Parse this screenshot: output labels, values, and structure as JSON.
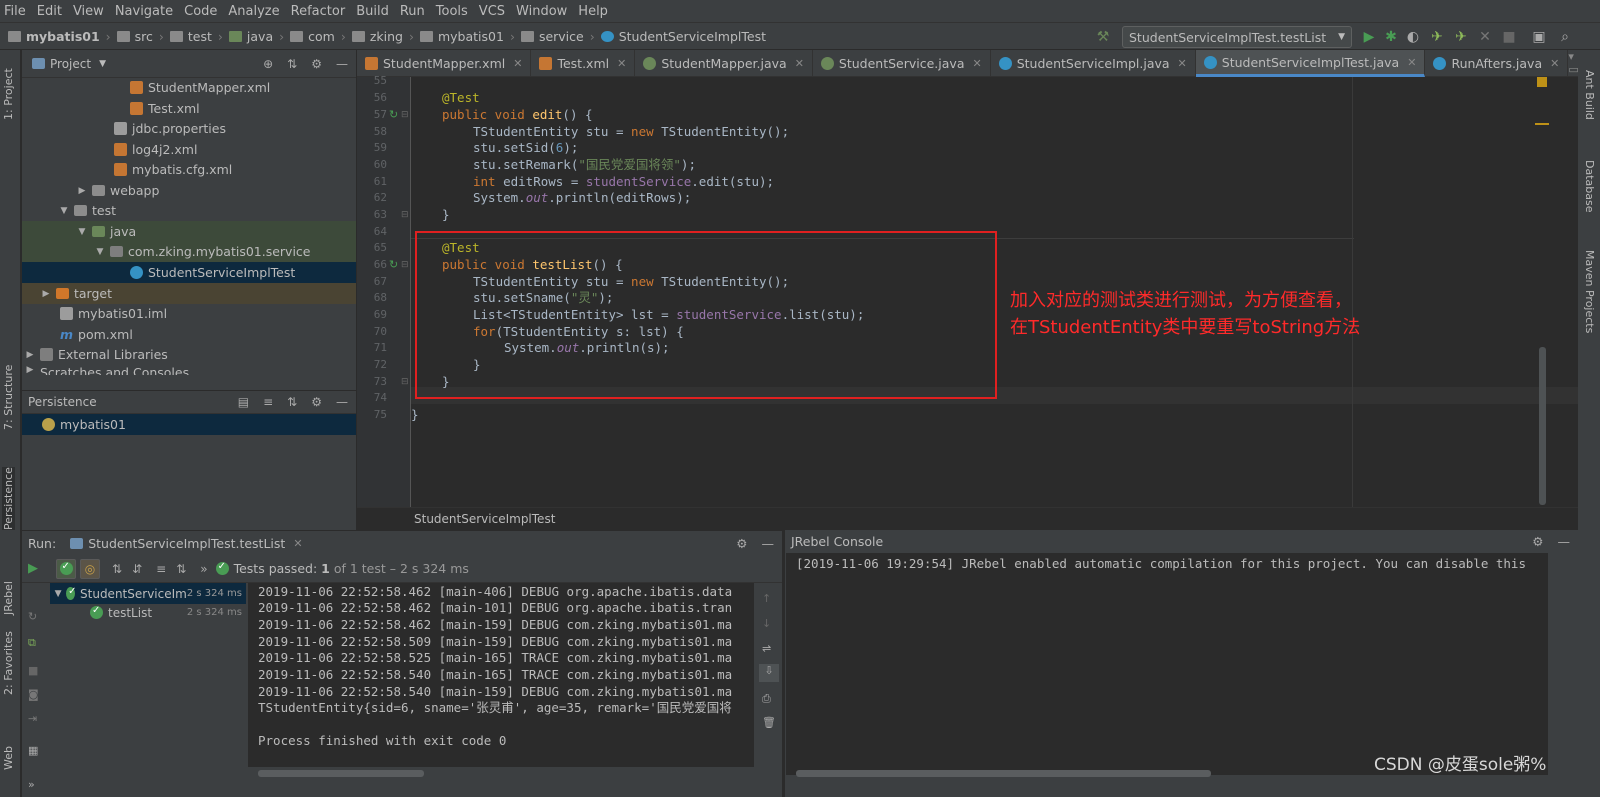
{
  "menu": [
    "File",
    "Edit",
    "View",
    "Navigate",
    "Code",
    "Analyze",
    "Refactor",
    "Build",
    "Run",
    "Tools",
    "VCS",
    "Window",
    "Help"
  ],
  "breadcrumb": [
    "mybatis01",
    "src",
    "test",
    "java",
    "com",
    "zking",
    "mybatis01",
    "service",
    "StudentServiceImplTest"
  ],
  "run_config": "StudentServiceImplTest.testList",
  "left_strip": [
    "1: Project",
    "7: Structure",
    "Persistence",
    "JRebel",
    "2: Favorites",
    "Web"
  ],
  "right_strip": [
    "Ant Build",
    "Database",
    "Maven Projects"
  ],
  "project": {
    "title": "Project",
    "items": [
      {
        "label": "StudentMapper.xml",
        "icon": "xml"
      },
      {
        "label": "Test.xml",
        "icon": "xml"
      },
      {
        "label": "jdbc.properties",
        "icon": "prop"
      },
      {
        "label": "log4j2.xml",
        "icon": "xml"
      },
      {
        "label": "mybatis.cfg.xml",
        "icon": "xml"
      },
      {
        "label": "webapp",
        "icon": "folder"
      },
      {
        "label": "test",
        "icon": ""
      },
      {
        "label": "java",
        "icon": "java"
      },
      {
        "label": "com.zking.mybatis01.service",
        "icon": "pkg"
      },
      {
        "label": "StudentServiceImplTest",
        "icon": "cls"
      },
      {
        "label": "target",
        "icon": "orange"
      },
      {
        "label": "mybatis01.iml",
        "icon": "prop"
      },
      {
        "label": "pom.xml",
        "icon": ""
      },
      {
        "label": "External Libraries",
        "icon": "lib"
      },
      {
        "label": "Scratches and Consoles",
        "icon": ""
      }
    ]
  },
  "persistence": {
    "title": "Persistence",
    "item": "mybatis01"
  },
  "tabs": [
    {
      "label": "StudentMapper.xml",
      "color": "#c57633"
    },
    {
      "label": "Test.xml",
      "color": "#c57633"
    },
    {
      "label": "StudentMapper.java",
      "color": "#6a8759"
    },
    {
      "label": "StudentService.java",
      "color": "#6a8759"
    },
    {
      "label": "StudentServiceImpl.java",
      "color": "#3592c4"
    },
    {
      "label": "StudentServiceImplTest.java",
      "color": "#3592c4"
    },
    {
      "label": "RunAfters.java",
      "color": "#3592c4"
    }
  ],
  "line_numbers": [
    "55",
    "56",
    "57",
    "58",
    "59",
    "60",
    "61",
    "62",
    "63",
    "64",
    "65",
    "66",
    "67",
    "68",
    "69",
    "70",
    "71",
    "72",
    "73",
    "74",
    "75"
  ],
  "code": {
    "l56": "@Test",
    "l57_kw1": "public void ",
    "l57_fn": "edit",
    "l57_rest": "() {",
    "l58_a": "TStudentEntity stu = ",
    "l58_kw": "new ",
    "l58_b": "TStudentEntity();",
    "l59_a": "stu.setSid(",
    "l59_num": "6",
    "l59_b": ");",
    "l60_a": "stu.setRemark(",
    "l60_str": "\"国民党爱国将领\"",
    "l60_b": ");",
    "l61_kw": "int ",
    "l61_a": "editRows = ",
    "l61_fld": "studentService",
    "l61_b": ".edit(stu);",
    "l62_a": "System.",
    "l62_it": "out",
    "l62_b": ".println(editRows);",
    "l63": "}",
    "l65": "@Test",
    "l66_kw1": "public void ",
    "l66_fn": "testList",
    "l66_rest": "() {",
    "l67_a": "TStudentEntity stu = ",
    "l67_kw": "new ",
    "l67_b": "TStudentEntity();",
    "l68_a": "stu.setSname(",
    "l68_str": "\"灵\"",
    "l68_b": ");",
    "l69_a": "List<TStudentEntity> lst = ",
    "l69_fld": "studentService",
    "l69_b": ".list(stu);",
    "l70_kw": "for",
    "l70_a": "(TStudentEntity s: lst) {",
    "l71_a": "System.",
    "l71_it": "out",
    "l71_b": ".println(s);",
    "l72": "}",
    "l73": "}",
    "l75": "}"
  },
  "annotation": {
    "line1": "加入对应的测试类进行测试，为方便查看，",
    "line2": "在TStudentEntity类中要重写toString方法"
  },
  "editor_footer": "StudentServiceImplTest",
  "run": {
    "label": "Run:",
    "tab": "StudentServiceImplTest.testList",
    "status_prefix": "Tests passed:",
    "status_count": "1",
    "status_rest": "of 1 test – 2 s 324 ms",
    "tree": [
      {
        "label": "StudentServiceIm",
        "time": "2 s 324 ms"
      },
      {
        "label": "testList",
        "time": "2 s 324 ms"
      }
    ],
    "console": [
      "2019-11-06 22:52:58.462 [main-406] DEBUG org.apache.ibatis.data",
      "2019-11-06 22:52:58.462 [main-101] DEBUG org.apache.ibatis.tran",
      "2019-11-06 22:52:58.462 [main-159] DEBUG com.zking.mybatis01.ma",
      "2019-11-06 22:52:58.509 [main-159] DEBUG com.zking.mybatis01.ma",
      "2019-11-06 22:52:58.525 [main-165] TRACE com.zking.mybatis01.ma",
      "2019-11-06 22:52:58.540 [main-165] TRACE com.zking.mybatis01.ma",
      "2019-11-06 22:52:58.540 [main-159] DEBUG com.zking.mybatis01.ma",
      "TStudentEntity{sid=6, sname='张灵甫', age=35, remark='国民党爱国将",
      "",
      "Process finished with exit code 0"
    ]
  },
  "jrebel": {
    "title": "JRebel Console",
    "line": "[2019-11-06 19:29:54] JRebel enabled automatic compilation for this project. You can disable this"
  },
  "watermark": "CSDN @皮蛋sole粥%"
}
